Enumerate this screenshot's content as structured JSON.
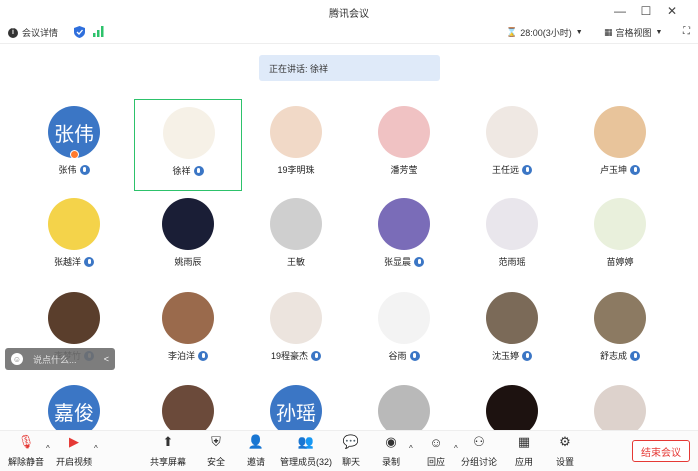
{
  "window": {
    "title": "腾讯会议"
  },
  "infobar": {
    "details_label": "会议详情",
    "timer": "28:00(3小时)",
    "view_label": "宫格视图"
  },
  "speaking": {
    "text": "正在讲话: 徐祥"
  },
  "participants": [
    {
      "name": "张伟",
      "avatar_text": "张伟",
      "mic": true,
      "host": true
    },
    {
      "name": "徐祥",
      "avatar_text": "",
      "mic": true,
      "active": true
    },
    {
      "name": "19李明珠",
      "avatar_text": "",
      "mic": false
    },
    {
      "name": "潘芳莹",
      "avatar_text": "",
      "mic": false
    },
    {
      "name": "王任远",
      "avatar_text": "",
      "mic": true
    },
    {
      "name": "卢玉坤",
      "avatar_text": "",
      "mic": true
    },
    {
      "name": "张越洋",
      "avatar_text": "",
      "mic": true
    },
    {
      "name": "姚雨辰",
      "avatar_text": "",
      "mic": false
    },
    {
      "name": "王敏",
      "avatar_text": "",
      "mic": false
    },
    {
      "name": "张显晨",
      "avatar_text": "",
      "mic": true
    },
    {
      "name": "范雨瑶",
      "avatar_text": "",
      "mic": false
    },
    {
      "name": "苗婷婷",
      "avatar_text": "",
      "mic": false
    },
    {
      "name": "李梦竹",
      "avatar_text": "",
      "mic": true
    },
    {
      "name": "李泊洋",
      "avatar_text": "",
      "mic": true
    },
    {
      "name": "19程豪杰",
      "avatar_text": "",
      "mic": true
    },
    {
      "name": "谷雨",
      "avatar_text": "",
      "mic": true
    },
    {
      "name": "沈玉婷",
      "avatar_text": "",
      "mic": true
    },
    {
      "name": "舒志成",
      "avatar_text": "",
      "mic": true
    },
    {
      "name": "",
      "avatar_text": "嘉俊",
      "mic": false
    },
    {
      "name": "",
      "avatar_text": "",
      "mic": false
    },
    {
      "name": "",
      "avatar_text": "孙瑶",
      "mic": false
    },
    {
      "name": "",
      "avatar_text": "",
      "mic": false
    },
    {
      "name": "",
      "avatar_text": "",
      "mic": false
    },
    {
      "name": "",
      "avatar_text": "",
      "mic": false
    }
  ],
  "avatar_colors": [
    "#3b76c5",
    "#f6f1e7",
    "#f1d9c7",
    "#f0c2c3",
    "#efe8e3",
    "#e8c49b",
    "#f4d34a",
    "#1a1e36",
    "#cfcfcf",
    "#7a6cb8",
    "#e9e6ec",
    "#e9f0dc",
    "#5a3e2c",
    "#9a6a4c",
    "#ece4de",
    "#f3f3f3",
    "#7b6a58",
    "#8c7a62",
    "#3b76c5",
    "#6b4a3a",
    "#3b76c5",
    "#b9b9b9",
    "#1d1210",
    "#ddd2cc"
  ],
  "comment": {
    "placeholder": "说点什么...",
    "arrow": "<"
  },
  "toolbar": {
    "items": [
      {
        "label": "解除静音",
        "icon": "mic-off-icon"
      },
      {
        "label": "开启视频",
        "icon": "video-off-icon"
      },
      {
        "label": "共享屏幕",
        "icon": "share-screen-icon"
      },
      {
        "label": "安全",
        "icon": "shield-icon"
      },
      {
        "label": "邀请",
        "icon": "invite-icon"
      },
      {
        "label": "管理成员(32)",
        "icon": "members-icon"
      },
      {
        "label": "聊天",
        "icon": "chat-icon"
      },
      {
        "label": "录制",
        "icon": "record-icon"
      },
      {
        "label": "回应",
        "icon": "reaction-icon"
      },
      {
        "label": "分组讨论",
        "icon": "breakout-icon"
      },
      {
        "label": "应用",
        "icon": "apps-icon"
      },
      {
        "label": "设置",
        "icon": "settings-icon"
      }
    ],
    "end_label": "结束会议"
  },
  "colors": {
    "accent": "#3b76c5",
    "active_border": "#2dc26b",
    "end_red": "#e53935",
    "banner": "#dfeaf9"
  }
}
